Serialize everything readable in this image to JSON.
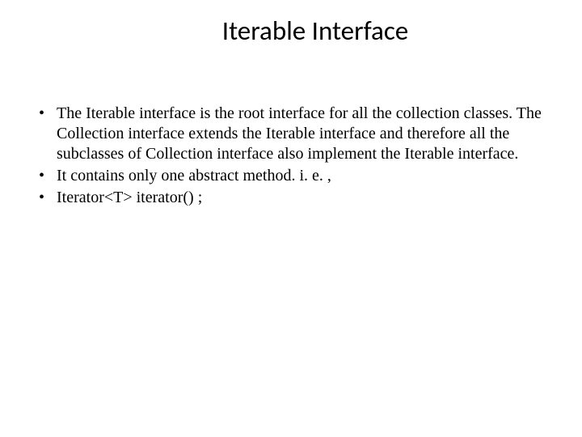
{
  "slide": {
    "title": "Iterable Interface",
    "bullets": [
      "The Iterable interface is the root interface for all the collection classes. The Collection interface extends the Iterable interface and therefore all the subclasses of Collection interface also implement the Iterable interface.",
      "It contains only one abstract method. i. e. ,",
      "Iterator<T> iterator()  ;"
    ]
  }
}
